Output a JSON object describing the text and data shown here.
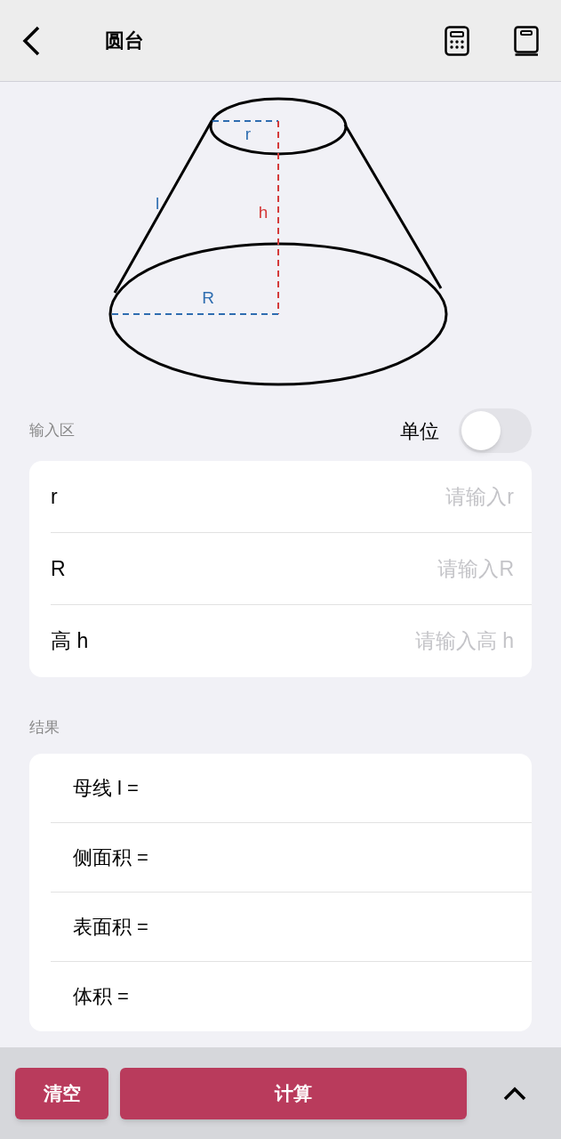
{
  "header": {
    "title": "圆台"
  },
  "diagram": {
    "labels": [
      {
        "text": "r",
        "kind": "radius"
      },
      {
        "text": "l",
        "kind": "radius"
      },
      {
        "text": "h",
        "kind": "height"
      },
      {
        "text": "R",
        "kind": "radius"
      }
    ]
  },
  "input_section": {
    "title": "输入区",
    "unit_label": "单位",
    "unit_toggle_on": false,
    "fields": [
      {
        "label": "r",
        "placeholder": "请输入r"
      },
      {
        "label": "R",
        "placeholder": "请输入R"
      },
      {
        "label": "高 h",
        "placeholder": "请输入高 h"
      }
    ]
  },
  "result_section": {
    "title": "结果",
    "rows": [
      "母线 l =",
      "侧面积 =",
      "表面积 =",
      "体积 ="
    ]
  },
  "bottom_bar": {
    "buttons": [
      {
        "label": "清空",
        "kind": "small"
      },
      {
        "label": "计算",
        "kind": "wide"
      }
    ]
  }
}
